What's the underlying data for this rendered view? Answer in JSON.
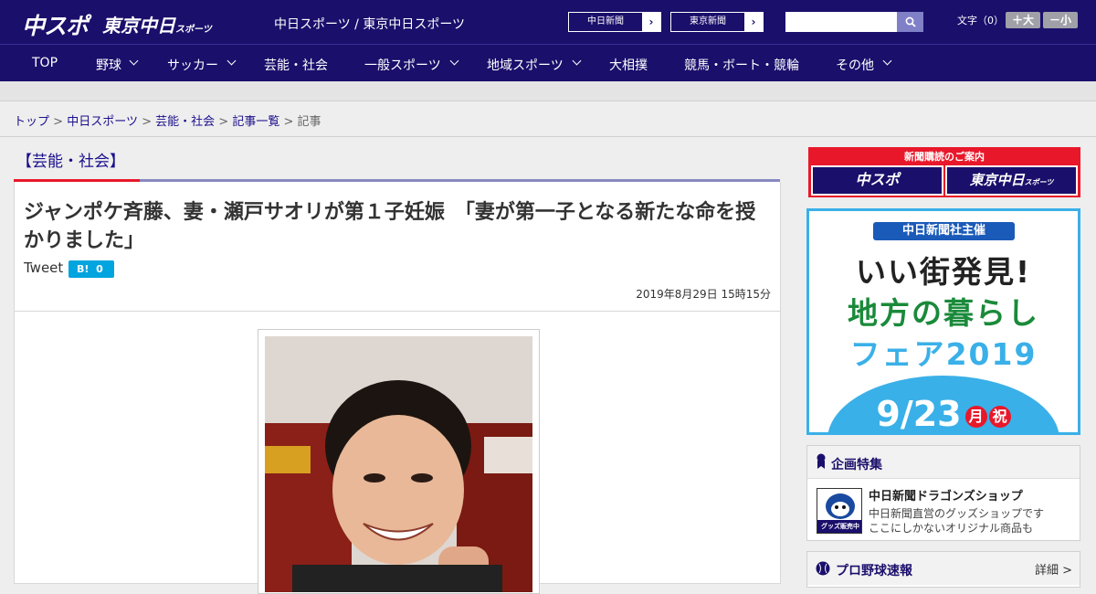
{
  "header": {
    "logo_main": "中スポ",
    "logo_sub": "東京中日",
    "logo_sub_small": "スポーツ",
    "tagline": "中日スポーツ / 東京中日スポーツ",
    "ext_links": [
      {
        "label": "中日新聞",
        "arrow": "›"
      },
      {
        "label": "東京新聞",
        "arrow": "›"
      }
    ],
    "search_placeholder": "",
    "font_size_label": "文字（0）",
    "font_larger": "＋大",
    "font_smaller": "－小"
  },
  "nav": [
    {
      "label": "TOP",
      "dropdown": false
    },
    {
      "label": "野球",
      "dropdown": true
    },
    {
      "label": "サッカー",
      "dropdown": true
    },
    {
      "label": "芸能・社会",
      "dropdown": false
    },
    {
      "label": "一般スポーツ",
      "dropdown": true
    },
    {
      "label": "地域スポーツ",
      "dropdown": true
    },
    {
      "label": "大相撲",
      "dropdown": false
    },
    {
      "label": "競馬・ボート・競輪",
      "dropdown": false
    },
    {
      "label": "その他",
      "dropdown": true
    }
  ],
  "breadcrumb": {
    "items": [
      "トップ",
      "中日スポーツ",
      "芸能・社会",
      "記事一覧"
    ],
    "current": "記事",
    "sep": ">"
  },
  "article": {
    "category": "【芸能・社会】",
    "headline": "ジャンポケ斉藤、妻・瀬戸サオリが第１子妊娠　「妻が第一子となる新たな命を授かりました」",
    "tweet_label": "Tweet",
    "hatena_label": "B!",
    "hatena_count": "0",
    "date": "2019年8月29日 15時15分"
  },
  "sidebar": {
    "subscribe_title": "新聞購読のご案内",
    "subscribe_left": "中スポ",
    "subscribe_right": "東京中日",
    "subscribe_right_small": "スポーツ",
    "fair": {
      "banner": "中日新聞社主催",
      "line1": "いい街発見!",
      "line2": "地方の暮らし",
      "line3": "フェア2019",
      "date": "9/23",
      "day": "月",
      "holiday": "祝"
    },
    "feature": {
      "title": "企画特集",
      "shop_name": "中日新聞ドラゴンズショップ",
      "shop_desc1": "中日新聞直営のグッズショップです",
      "shop_desc2": "ここにしかないオリジナル商品も",
      "thumb_label": "グッズ販売中"
    },
    "baseball": {
      "title": "プロ野球速報",
      "more": "詳細 >"
    }
  },
  "colors": {
    "navy": "#1a0f6b",
    "accent_red": "#e8182a",
    "hatena_blue": "#00a4de",
    "fair_blue": "#3ab0e8"
  }
}
